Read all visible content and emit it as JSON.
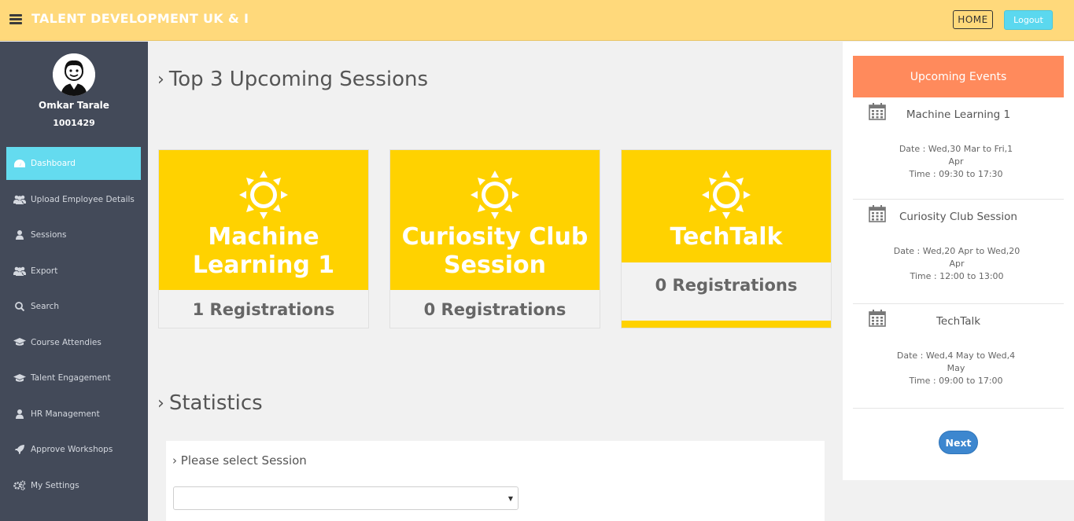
{
  "header": {
    "title": "TALENT DEVELOPMENT UK & I",
    "home_label": "HOME",
    "logout_label": "Logout"
  },
  "user": {
    "name": "Omkar Tarale",
    "id": "1001429"
  },
  "sidebar": {
    "items": [
      {
        "label": "Dashboard",
        "icon": "dashboard-icon",
        "active": true
      },
      {
        "label": "Upload Employee Details",
        "icon": "users-icon"
      },
      {
        "label": "Sessions",
        "icon": "user-icon"
      },
      {
        "label": "Export",
        "icon": "users-icon"
      },
      {
        "label": "Search",
        "icon": "search-icon"
      },
      {
        "label": "Course Attendies",
        "icon": "graduation-cap-icon"
      },
      {
        "label": "Talent Engagement",
        "icon": "graduation-cap-icon"
      },
      {
        "label": "HR Management",
        "icon": "user-icon"
      },
      {
        "label": "Approve Workshops",
        "icon": "rocket-icon"
      },
      {
        "label": "My Settings",
        "icon": "gears-icon"
      }
    ]
  },
  "main": {
    "sessions_title": "Top 3 Upcoming Sessions",
    "sessions": [
      {
        "title_line1": "Machine",
        "title_line2": "Learning 1",
        "registrations": "1 Registrations"
      },
      {
        "title_line1": "Curiosity Club",
        "title_line2": "Session",
        "registrations": "0 Registrations"
      },
      {
        "title_line1": "TechTalk",
        "title_line2": "",
        "registrations": "0 Registrations"
      }
    ],
    "statistics_title": "Statistics",
    "select_label": "Please select Session",
    "select_value": ""
  },
  "events": {
    "header": "Upcoming Events",
    "items": [
      {
        "name": "Machine Learning 1",
        "date_line1": "Date : Wed,30 Mar to Fri,1",
        "date_line2": "Apr",
        "time": "Time : 09:30 to 17:30"
      },
      {
        "name": "Curiosity Club Session",
        "date_line1": "Date : Wed,20 Apr to Wed,20",
        "date_line2": "Apr",
        "time": "Time : 12:00 to 13:00"
      },
      {
        "name": "TechTalk",
        "date_line1": "Date : Wed,4 May to Wed,4",
        "date_line2": "May",
        "time": "Time : 09:00 to 17:00"
      }
    ],
    "next_label": "Next"
  },
  "colors": {
    "header_bg": "#ffd97b",
    "sidebar_bg": "#434a59",
    "active_nav": "#64dbef",
    "card_yellow": "#ffd200",
    "events_header": "#ff8a5c",
    "next_button": "#3d87cf"
  }
}
